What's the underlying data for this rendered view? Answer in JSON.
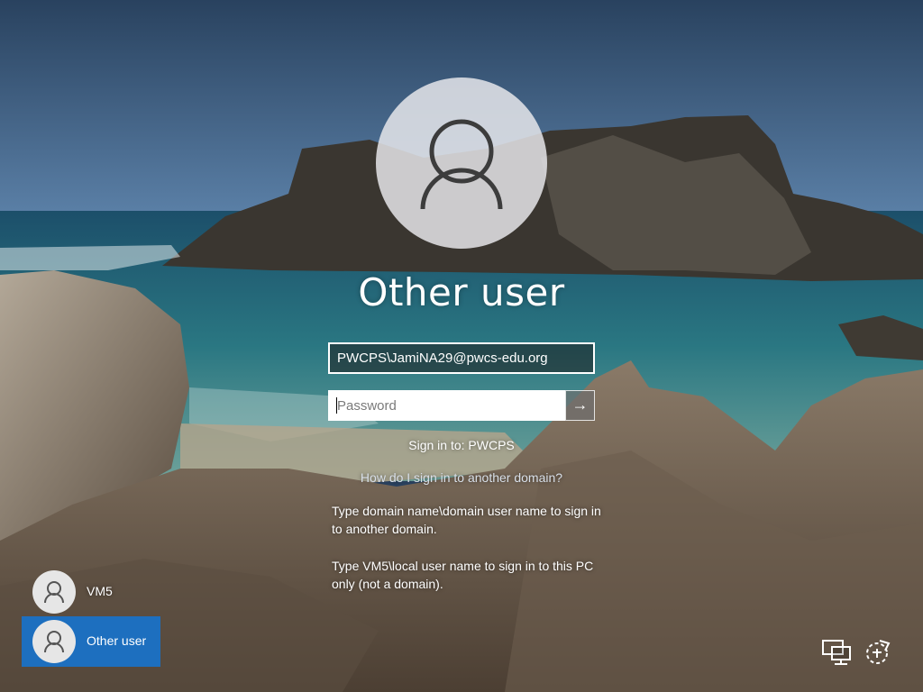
{
  "login": {
    "username_heading": "Other user",
    "user_field_value": "PWCPS\\JamiNA29@pwcs-edu.org",
    "password_placeholder": "Password",
    "submit_glyph": "→",
    "sign_in_to": "Sign in to: PWCPS",
    "help_link": "How do I sign in to another domain?",
    "help_text_1": "Type domain name\\domain user name to sign in to another domain.",
    "help_text_2": "Type VM5\\local user name to sign in to this PC only (not a domain)."
  },
  "user_tiles": [
    {
      "label": "VM5",
      "icon": "user-icon",
      "selected": false
    },
    {
      "label": "Other user",
      "icon": "user-icon",
      "selected": true
    }
  ],
  "tray": {
    "network_icon": "network-icon",
    "ease_of_access_icon": "ease-of-access-icon"
  },
  "colors": {
    "selected_tile": "#1d6fbf",
    "input_border": "#ffffff",
    "text": "#ffffff"
  }
}
